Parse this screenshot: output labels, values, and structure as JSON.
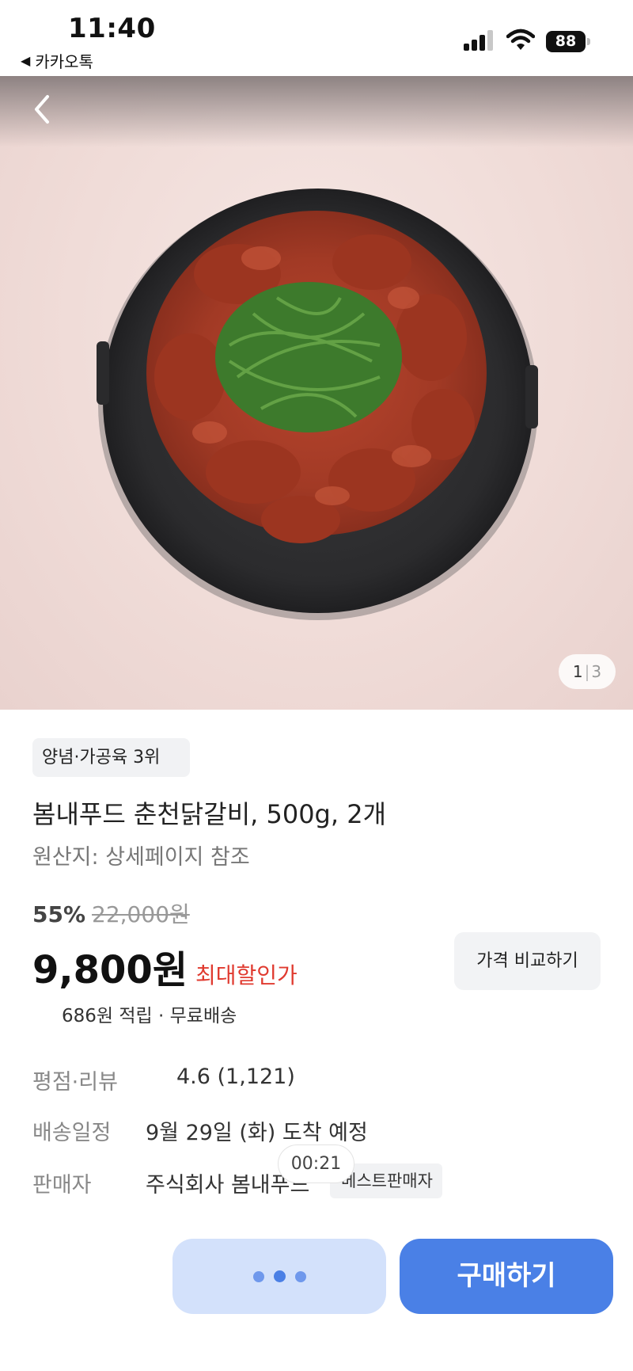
{
  "status_bar": {
    "time": "11:40",
    "back_app": "카카오톡",
    "battery": "88"
  },
  "hero": {
    "image_index": "1",
    "image_total": "3",
    "image_description_icon": "food-photo-chicken-galbi"
  },
  "product": {
    "rank_badge": "양념·가공육 3위",
    "title": "봄내푸드 춘천닭갈비, 500g, 2개",
    "origin": "원산지: 상세페이지 참조",
    "discount_rate": "55%",
    "original_price": "22,000원",
    "price": "9,800원",
    "price_tag": "최대할인가",
    "compare_button": "가격 비교하기",
    "points_shipping": "686원 적립 · 무료배송"
  },
  "details": {
    "rating_label": "평점·리뷰",
    "rating_value": "4.6 (1,121)",
    "delivery_label": "배송일정",
    "delivery_value": "9월 29일 (화) 도착 예정",
    "seller_label": "판매자",
    "seller_value": "주식회사 봄내푸드",
    "seller_badge": "베스트판매자"
  },
  "overlay": {
    "timer": "00:21"
  },
  "bottom_bar": {
    "buy_label": "구매하기"
  },
  "colors": {
    "accent": "#4a80e6",
    "accent_light": "#d3e1fb",
    "sale_red": "#e03a2f"
  }
}
